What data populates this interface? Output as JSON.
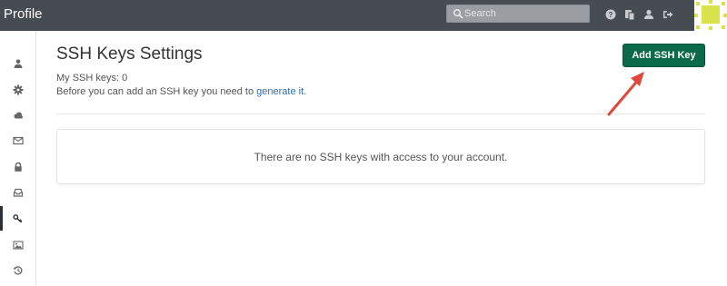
{
  "header": {
    "title": "Profile",
    "search": {
      "placeholder": "Search",
      "value": ""
    },
    "icons": [
      "help-icon",
      "clipboard-icon",
      "user-icon",
      "logout-icon"
    ]
  },
  "sidebar": {
    "items": [
      {
        "name": "user-icon",
        "active": false
      },
      {
        "name": "gear-icon",
        "active": false
      },
      {
        "name": "cloud-icon",
        "active": false
      },
      {
        "name": "mail-icon",
        "active": false
      },
      {
        "name": "lock-icon",
        "active": false
      },
      {
        "name": "inbox-icon",
        "active": false
      },
      {
        "name": "key-icon",
        "active": true
      },
      {
        "name": "image-icon",
        "active": false
      },
      {
        "name": "history-icon",
        "active": false
      }
    ]
  },
  "main": {
    "title": "SSH Keys Settings",
    "keys_count": "My SSH keys: 0",
    "hint_prefix": "Before you can add an SSH key you need to ",
    "hint_link": "generate it",
    "hint_suffix": ".",
    "add_button": "Add SSH Key",
    "empty_message": "There are no SSH keys with access to your account."
  },
  "colors": {
    "header_bg": "#474b52",
    "accent_button": "#0b6a4a",
    "link": "#2a6ebb",
    "annotation_arrow": "#e0483c",
    "avatar": "#d8e24a"
  }
}
